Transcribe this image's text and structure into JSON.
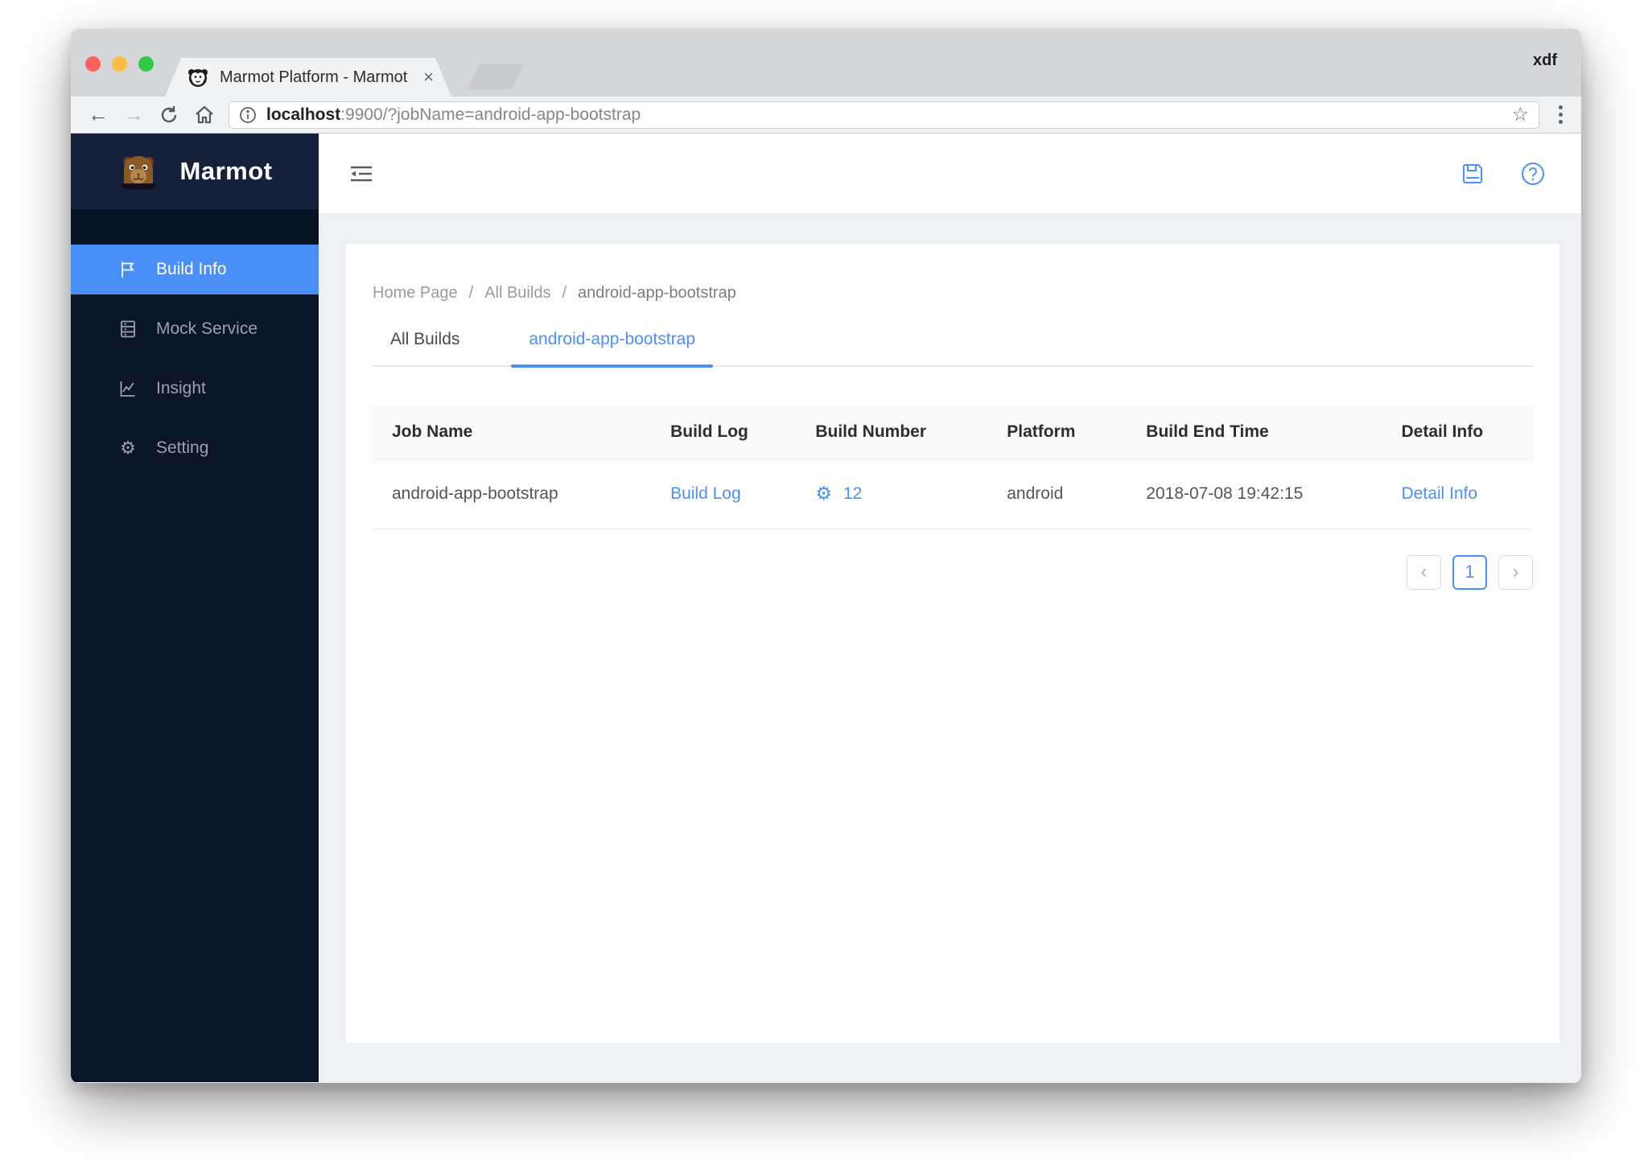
{
  "browser": {
    "profile": "xdf",
    "tab": {
      "title": "Marmot Platform - Marmot",
      "close_glyph": "×"
    },
    "url": {
      "host": "localhost",
      "rest": ":9900/?jobName=android-app-bootstrap"
    },
    "icons": {
      "back": "←",
      "forward": "→",
      "star": "☆"
    }
  },
  "sidebar": {
    "logo_text": "Marmot",
    "items": [
      {
        "label": "Build Info",
        "icon": "flag-icon",
        "active": true
      },
      {
        "label": "Mock Service",
        "icon": "database-icon",
        "active": false
      },
      {
        "label": "Insight",
        "icon": "chart-icon",
        "active": false
      },
      {
        "label": "Setting",
        "icon": "gear-icon",
        "active": false
      }
    ],
    "gear_glyph": "⚙"
  },
  "breadcrumb": {
    "separator": "/",
    "items": [
      "Home Page",
      "All Builds",
      "android-app-bootstrap"
    ]
  },
  "tabs": {
    "items": [
      {
        "label": "All Builds",
        "active": false
      },
      {
        "label": "android-app-bootstrap",
        "active": true
      }
    ]
  },
  "table": {
    "columns": [
      "Job Name",
      "Build Log",
      "Build Number",
      "Platform",
      "Build End Time",
      "Detail Info"
    ],
    "rows": [
      {
        "job_name": "android-app-bootstrap",
        "build_log_label": "Build Log",
        "build_number": "12",
        "gear_glyph": "⚙",
        "platform": "android",
        "build_end_time": "2018-07-08 19:42:15",
        "detail_info_label": "Detail Info"
      }
    ]
  },
  "pagination": {
    "prev_glyph": "‹",
    "page": "1",
    "next_glyph": "›"
  },
  "colors": {
    "accent": "#4a90f8",
    "sidebar_bg": "#0b1729",
    "sidebar_logo_bg": "#15213a",
    "active_menu_bg": "#4a8ff8",
    "content_bg": "#eef0f4",
    "table_header_bg": "#fafafa",
    "border": "#e8e8e8"
  }
}
